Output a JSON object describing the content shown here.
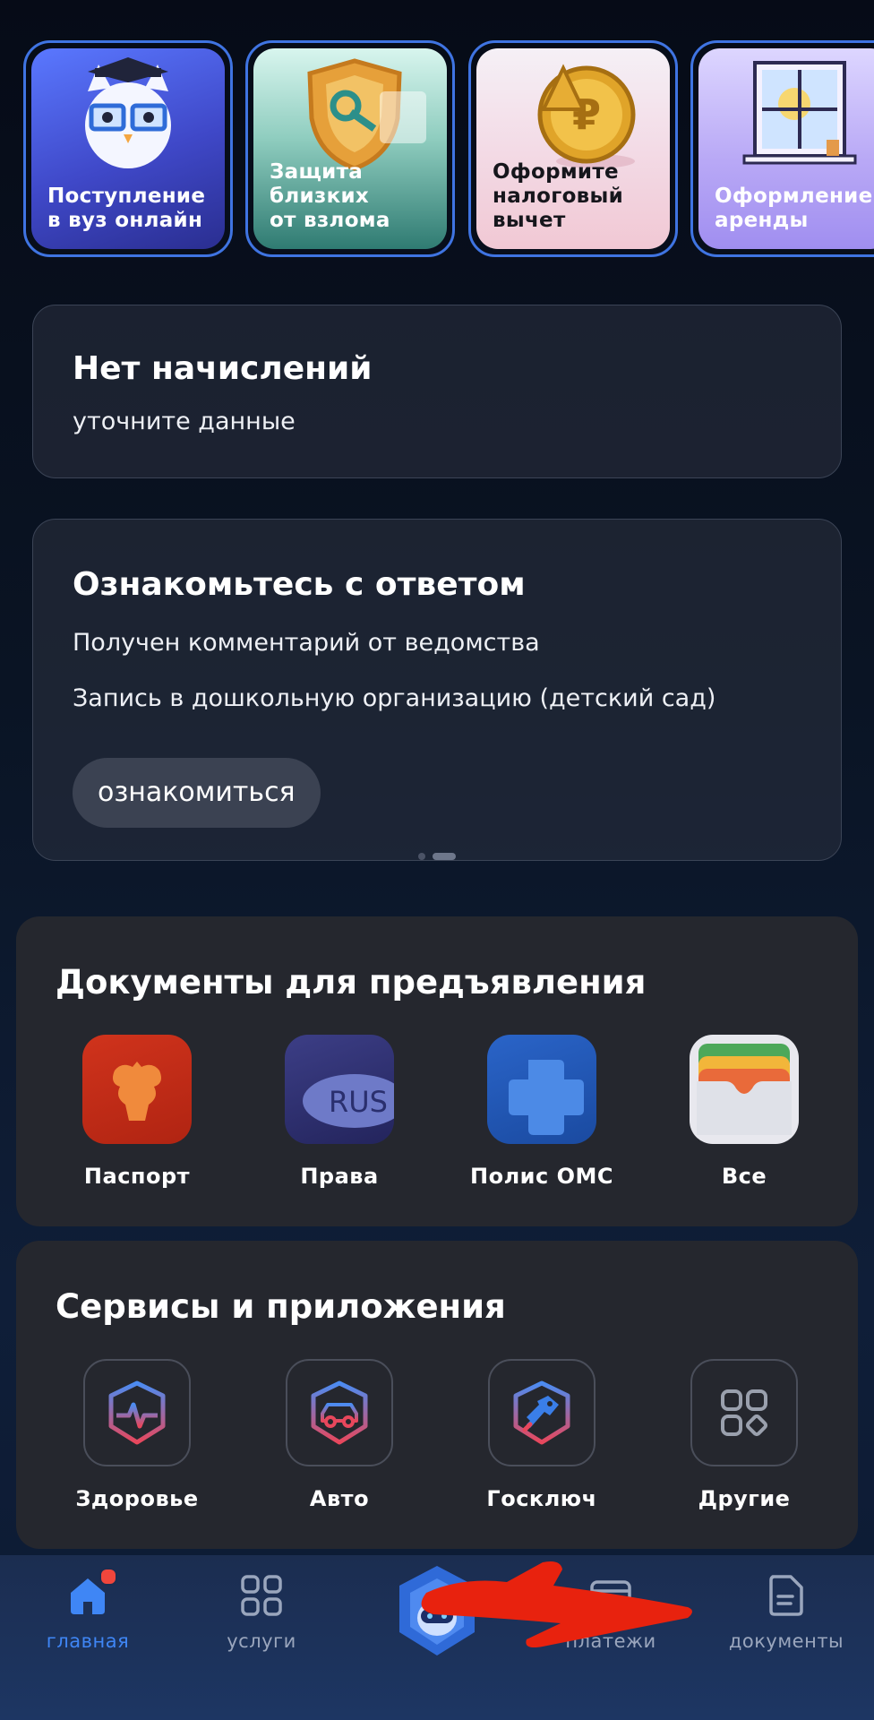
{
  "stories": [
    {
      "title": "Поступление\nв вуз онлайн",
      "art": "owl-mascot-image"
    },
    {
      "title": "Защита\nблизких\nот взлома",
      "art": "shield-key-image"
    },
    {
      "title": "Оформите\nналоговый\nвычет",
      "art": "gold-coin-image"
    },
    {
      "title": "Оформление\nаренды",
      "art": "window-sun-image"
    }
  ],
  "charges_card": {
    "title": "Нет начислений",
    "subtitle": "уточните данные"
  },
  "answer_card": {
    "title": "Ознакомьтесь с ответом",
    "line1": "Получен комментарий от ведомства",
    "line2": "Запись в дошкольную организацию (детский сад)",
    "button": "ознакомиться"
  },
  "documents": {
    "title": "Документы для предъявления",
    "items": [
      {
        "label": "Паспорт",
        "icon": "passport-eagle-icon"
      },
      {
        "label": "Права",
        "icon": "drivers-license-icon",
        "icon_text": "RUS"
      },
      {
        "label": "Полис ОМС",
        "icon": "medical-cross-icon"
      },
      {
        "label": "Все",
        "icon": "wallet-icon"
      }
    ]
  },
  "services": {
    "title": "Сервисы и приложения",
    "items": [
      {
        "label": "Здоровье",
        "icon": "health-pulse-icon"
      },
      {
        "label": "Авто",
        "icon": "car-icon"
      },
      {
        "label": "Госключ",
        "icon": "key-icon"
      },
      {
        "label": "Другие",
        "icon": "grid-icon"
      }
    ]
  },
  "bottom_nav": {
    "home": "главная",
    "services": "услуги",
    "payments": "платежи",
    "documents": "документы"
  },
  "colors": {
    "accent": "#3f86f5",
    "story_border": "#3f74e2",
    "badge": "#f0463c",
    "annotation_arrow": "#e8220e"
  }
}
